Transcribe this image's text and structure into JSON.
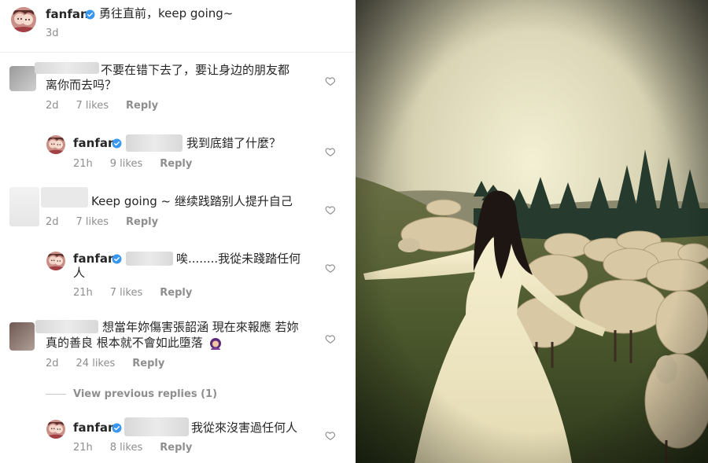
{
  "post": {
    "username": "fanfan",
    "caption": "勇往直前，keep going~",
    "time": "3d"
  },
  "comments": [
    {
      "text_line1": "不要在错下去了，要让身边的朋友都",
      "text_line2": "离你而去吗？",
      "time": "2d",
      "likes": "7 likes",
      "reply": "Reply"
    },
    {
      "username": "fanfan",
      "text": "我到底錯了什麼？",
      "time": "21h",
      "likes": "9 likes",
      "reply": "Reply"
    },
    {
      "text": "Keep going ~ 继续践踏别人提升自己",
      "time": "2d",
      "likes": "7 likes",
      "reply": "Reply"
    },
    {
      "username": "fanfan",
      "text_line1": "唉........我從未踐踏任何",
      "text_line2": "人",
      "time": "21h",
      "likes": "7 likes",
      "reply": "Reply"
    },
    {
      "text_line1": "想當年妳傷害張韶涵 現在來報應 若妳",
      "text_line2": "真的善良 根本就不會如此墮落",
      "time": "2d",
      "likes": "24 likes",
      "reply": "Reply"
    },
    {
      "view_previous": "View previous replies (1)"
    },
    {
      "username": "fanfan",
      "text": "我從來沒害過任何人",
      "time": "21h",
      "likes": "8 likes",
      "reply": "Reply"
    }
  ],
  "colors": {
    "verified": "#3897f0",
    "meta": "#8e8e8e",
    "text": "#262626"
  }
}
